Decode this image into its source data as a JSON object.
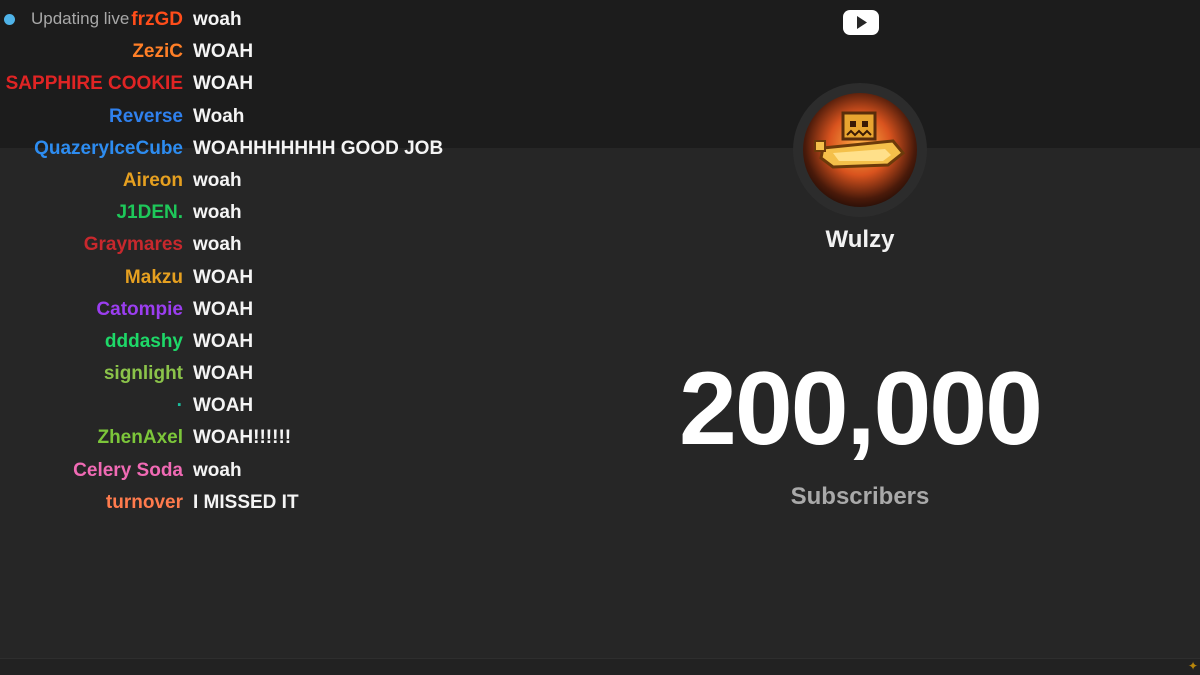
{
  "live_status": {
    "text": "Updating live",
    "dot_color": "#4fb3e8"
  },
  "chat": [
    {
      "name": "frzGD",
      "message": "woah",
      "color": "#ff4d1a"
    },
    {
      "name": "ZeziC",
      "message": "WOAH",
      "color": "#ff7f27"
    },
    {
      "name": "K SAPPHIRE COOKIE",
      "message": "WOAH",
      "color": "#e02424"
    },
    {
      "name": "Reverse",
      "message": "Woah",
      "color": "#2f80ed"
    },
    {
      "name": "QuazeryIceCube",
      "message": "WOAHHHHHHH GOOD JOB",
      "color": "#2d8cf0"
    },
    {
      "name": "Aireon",
      "message": "woah",
      "color": "#e6a020"
    },
    {
      "name": "J1DEN.",
      "message": "woah",
      "color": "#1ec85a"
    },
    {
      "name": "Graymares",
      "message": "woah",
      "color": "#c8282d"
    },
    {
      "name": "Makzu",
      "message": "WOAH",
      "color": "#e6a020"
    },
    {
      "name": "Catompie",
      "message": "WOAH",
      "color": "#9b3ef0"
    },
    {
      "name": "dddashy",
      "message": "WOAH",
      "color": "#1ed868"
    },
    {
      "name": "signlight",
      "message": "WOAH",
      "color": "#8bc34a"
    },
    {
      "name": "·",
      "message": "WOAH",
      "color": "#1abc9c"
    },
    {
      "name": "ZhenAxel",
      "message": "WOAH!!!!!!",
      "color": "#7cc63a"
    },
    {
      "name": "Celery Soda",
      "message": "woah",
      "color": "#f06ab4"
    },
    {
      "name": "turnover",
      "message": "I MISSED IT",
      "color": "#ff7b4d"
    }
  ],
  "channel": {
    "logo_icon": "youtube-play-icon",
    "avatar_icon": "pixel-character-avatar",
    "name": "Wulzy",
    "subscriber_count": "200,000",
    "subscriber_label": "Subscribers"
  }
}
